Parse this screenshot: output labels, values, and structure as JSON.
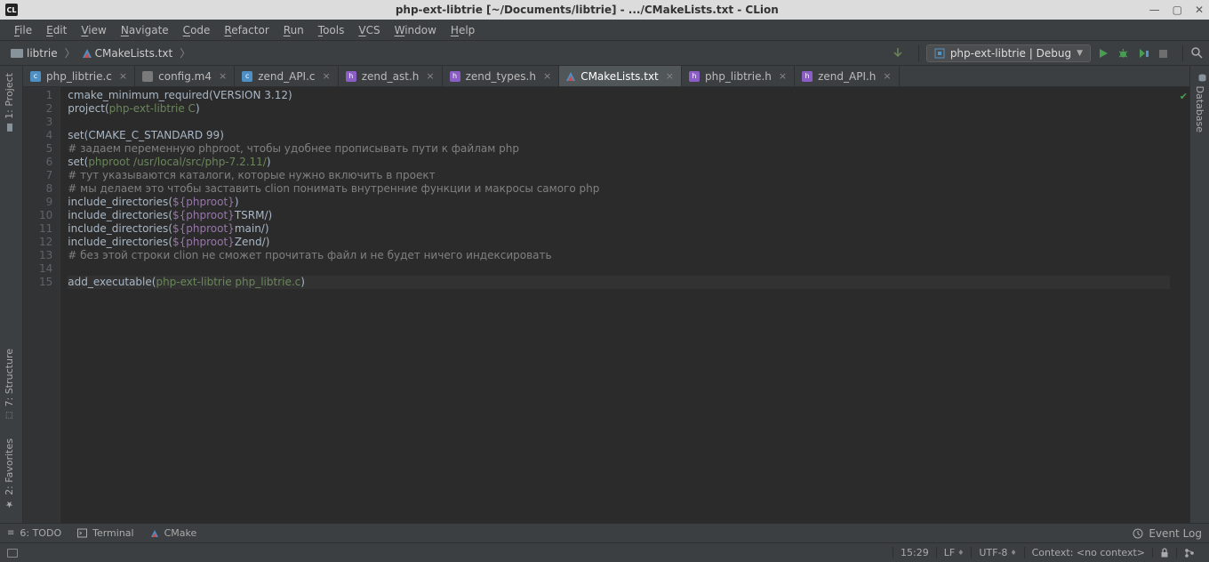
{
  "window": {
    "title": "php-ext-libtrie [~/Documents/libtrie] - .../CMakeLists.txt - CLion",
    "app_icon_text": "CL"
  },
  "menu": [
    "File",
    "Edit",
    "View",
    "Navigate",
    "Code",
    "Refactor",
    "Run",
    "Tools",
    "VCS",
    "Window",
    "Help"
  ],
  "breadcrumb": {
    "project": "libtrie",
    "file": "CMakeLists.txt"
  },
  "run_config": "php-ext-libtrie | Debug",
  "tabs": [
    {
      "name": "php_libtrie.c",
      "type": "c",
      "active": false
    },
    {
      "name": "config.m4",
      "type": "txt",
      "active": false
    },
    {
      "name": "zend_API.c",
      "type": "c",
      "active": false
    },
    {
      "name": "zend_ast.h",
      "type": "h",
      "active": false
    },
    {
      "name": "zend_types.h",
      "type": "h",
      "active": false
    },
    {
      "name": "CMakeLists.txt",
      "type": "cmake",
      "active": true
    },
    {
      "name": "php_libtrie.h",
      "type": "h",
      "active": false
    },
    {
      "name": "zend_API.h",
      "type": "h",
      "active": false
    }
  ],
  "left_tools": {
    "project": "1: Project",
    "structure": "7: Structure",
    "favorites": "2: Favorites"
  },
  "right_tools": {
    "database": "Database"
  },
  "code_lines": [
    {
      "n": 1,
      "tokens": [
        [
          "fn",
          "cmake_minimum_required"
        ],
        [
          "paren",
          "("
        ],
        [
          "arg",
          "VERSION 3.12"
        ],
        [
          "paren",
          ")"
        ]
      ]
    },
    {
      "n": 2,
      "tokens": [
        [
          "fn",
          "project"
        ],
        [
          "paren",
          "("
        ],
        [
          "str",
          "php-ext-libtrie C"
        ],
        [
          "paren",
          ")"
        ]
      ]
    },
    {
      "n": 3,
      "tokens": []
    },
    {
      "n": 4,
      "tokens": [
        [
          "fn",
          "set"
        ],
        [
          "paren",
          "("
        ],
        [
          "arg",
          "CMAKE_C_STANDARD 99"
        ],
        [
          "paren",
          ")"
        ]
      ]
    },
    {
      "n": 5,
      "tokens": [
        [
          "cmt",
          "# задаем переменную phproot, чтобы удобнее прописывать пути к файлам php"
        ]
      ]
    },
    {
      "n": 6,
      "tokens": [
        [
          "fn",
          "set"
        ],
        [
          "paren",
          "("
        ],
        [
          "str",
          "phproot /usr/local/src/php-7.2.11/"
        ],
        [
          "paren",
          ")"
        ]
      ]
    },
    {
      "n": 7,
      "tokens": [
        [
          "cmt",
          "# тут указываются каталоги, которые нужно включить в проект"
        ]
      ]
    },
    {
      "n": 8,
      "tokens": [
        [
          "cmt",
          "# мы делаем это чтобы заставить clion понимать внутренние функции и макросы самого php"
        ]
      ]
    },
    {
      "n": 9,
      "tokens": [
        [
          "fn",
          "include_directories"
        ],
        [
          "paren",
          "("
        ],
        [
          "var",
          "${phproot}"
        ],
        [
          "paren",
          ")"
        ]
      ]
    },
    {
      "n": 10,
      "tokens": [
        [
          "fn",
          "include_directories"
        ],
        [
          "paren",
          "("
        ],
        [
          "var",
          "${phproot}"
        ],
        [
          "arg",
          "TSRM/"
        ],
        [
          "paren",
          ")"
        ]
      ]
    },
    {
      "n": 11,
      "tokens": [
        [
          "fn",
          "include_directories"
        ],
        [
          "paren",
          "("
        ],
        [
          "var",
          "${phproot}"
        ],
        [
          "arg",
          "main/"
        ],
        [
          "paren",
          ")"
        ]
      ]
    },
    {
      "n": 12,
      "tokens": [
        [
          "fn",
          "include_directories"
        ],
        [
          "paren",
          "("
        ],
        [
          "var",
          "${phproot}"
        ],
        [
          "arg",
          "Zend/"
        ],
        [
          "paren",
          ")"
        ]
      ]
    },
    {
      "n": 13,
      "tokens": [
        [
          "cmt",
          "# без этой строки clion не сможет прочитать файл и не будет ничего индексировать"
        ]
      ]
    },
    {
      "n": 14,
      "tokens": []
    },
    {
      "n": 15,
      "hl": true,
      "tokens": [
        [
          "fn",
          "add_executable"
        ],
        [
          "paren",
          "("
        ],
        [
          "str",
          "php-ext-libtrie php_libtrie.c"
        ],
        [
          "paren",
          ")"
        ]
      ]
    }
  ],
  "bottom_tools": {
    "todo": "6: TODO",
    "terminal": "Terminal",
    "cmake": "CMake",
    "event_log": "Event Log"
  },
  "status": {
    "position": "15:29",
    "line_sep": "LF",
    "encoding": "UTF-8",
    "context": "Context: <no context>"
  }
}
